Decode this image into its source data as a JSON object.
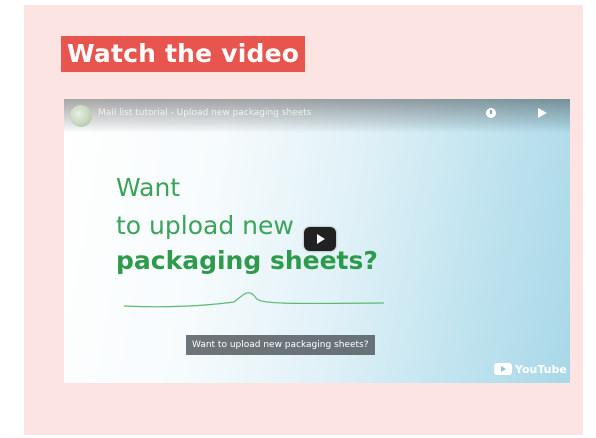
{
  "section": {
    "heading": "Watch the video"
  },
  "video": {
    "title": "Mail list tutorial - Upload new packaging sheets",
    "headline_line1": "Want",
    "headline_line2": "to upload new",
    "headline_line3": "packaging sheets?",
    "caption": "Want to upload new packaging sheets?",
    "platform_label": "YouTube",
    "icons": {
      "channel": "channel-logo-icon",
      "watch_later": "clock-icon",
      "share": "share-icon",
      "play": "play-icon",
      "platform": "youtube-logo-icon"
    }
  },
  "colors": {
    "page_background": "#fce4e3",
    "heading_background": "#e8554e",
    "heading_text": "#ffffff",
    "headline_green": "#3ca35a",
    "play_button": "#212121"
  }
}
